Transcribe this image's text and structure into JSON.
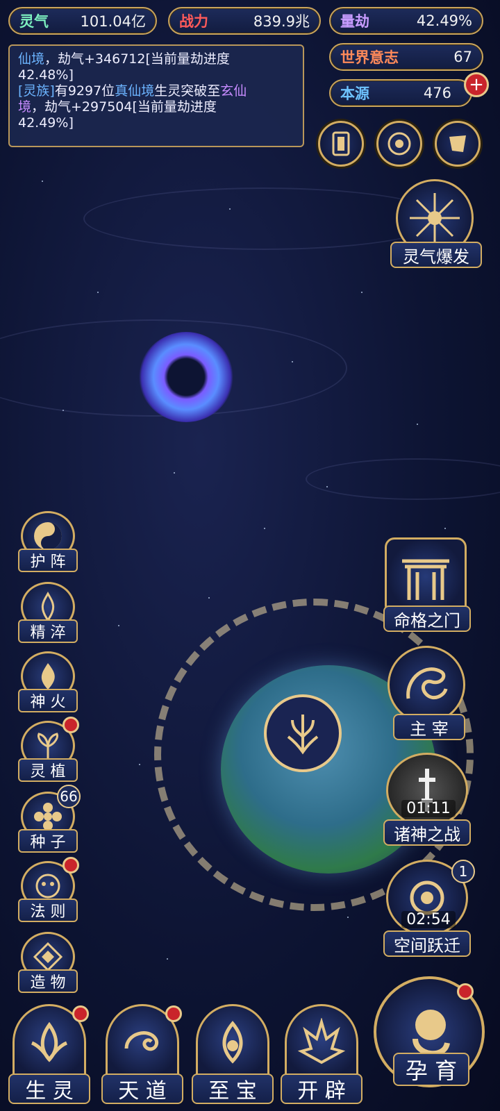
{
  "stats": {
    "lingqi": {
      "label": "灵气",
      "value": "101.04亿",
      "color": "#7df0c0"
    },
    "zhanli": {
      "label": "战力",
      "value": "839.9兆",
      "color": "#ff5a5a"
    },
    "lianjie": {
      "label": "量劫",
      "value": "42.49%",
      "color": "#c89cff"
    },
    "world_will": {
      "label": "世界意志",
      "value": "67",
      "color": "#ff8a5a"
    },
    "benyuan": {
      "label": "本源",
      "value": "476",
      "color": "#6ec3ff"
    }
  },
  "log": {
    "line1_realm": "仙境",
    "line1_rest": "，劫气+346712[当前量劫进度",
    "line2": "42.48%]",
    "line3_race": "[灵族]",
    "line3_mid1": "有9297位",
    "line3_realm1": "真仙境",
    "line3_mid2": "生灵突破至",
    "line3_realm2": "玄仙",
    "line4_realm": "境",
    "line4_rest": "，劫气+297504[当前量劫进度",
    "line5": "42.49%]"
  },
  "burst": {
    "label": "灵气爆发"
  },
  "left_menu": [
    {
      "label": "护 阵",
      "icon": "yin-yang-icon"
    },
    {
      "label": "精 淬",
      "icon": "lotus-flame-icon"
    },
    {
      "label": "神 火",
      "icon": "fire-icon"
    },
    {
      "label": "灵 植",
      "icon": "plant-icon"
    },
    {
      "label": "种 子",
      "icon": "seed-flower-icon",
      "badge": "66"
    },
    {
      "label": "法 则",
      "icon": "rune-icon"
    },
    {
      "label": "造 物",
      "icon": "diamond-icon"
    }
  ],
  "right_menu": {
    "fate_gate": "命格之门",
    "master": "主 宰",
    "gods_war": "诸神之战",
    "gods_timer": "01:11",
    "space_jump": "空间跃迁",
    "space_timer": "02:54",
    "space_badge": "1"
  },
  "bottom_menu": [
    "生 灵",
    "天 道",
    "至 宝",
    "开 辟"
  ],
  "nurture": "孕 育"
}
